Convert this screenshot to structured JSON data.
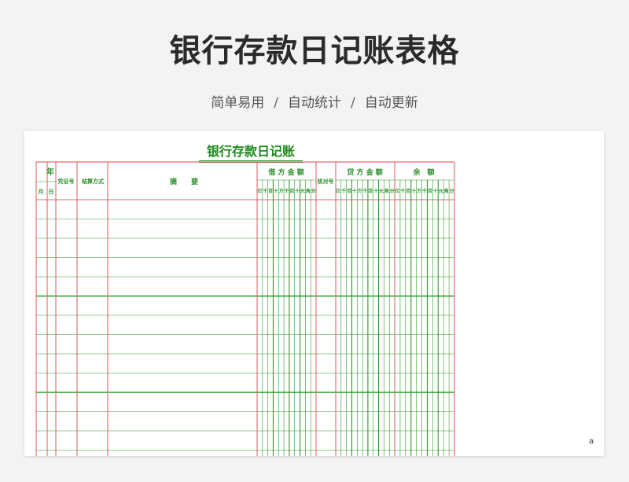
{
  "page": {
    "title": "银行存款日记账表格",
    "tags": [
      "简单易用",
      "自动统计",
      "自动更新"
    ],
    "separator": "/"
  },
  "ledger": {
    "title": "银行存款日记账",
    "headers": {
      "year": "年",
      "month": "月",
      "day": "日",
      "voucher": "凭证号",
      "settlement": "结算方式",
      "summary": "摘　　要",
      "debit": "借 方 金 额",
      "check": "核对号",
      "credit": "贷 方 金 额",
      "balance": "余　额"
    },
    "digit_units": [
      "亿",
      "千",
      "百",
      "十",
      "万",
      "千",
      "百",
      "十",
      "元",
      "角",
      "分"
    ],
    "balance_units": [
      "亿",
      "千",
      "百",
      "十",
      "万",
      "千",
      "百",
      "十",
      "元",
      "角",
      " 分"
    ],
    "page_mark": "a",
    "body_rows": 13
  },
  "colors": {
    "red_line": "#e06a6a",
    "green_line": "#2c9a2c",
    "title_green": "#1a8a1a"
  }
}
